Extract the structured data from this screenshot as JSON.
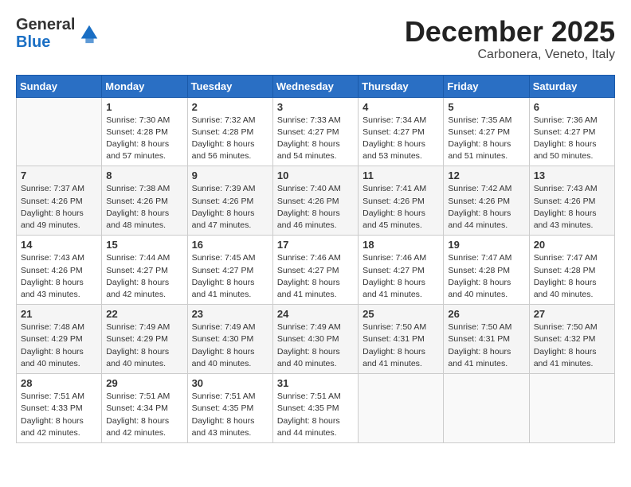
{
  "header": {
    "logo_line1": "General",
    "logo_line2": "Blue",
    "month": "December 2025",
    "location": "Carbonera, Veneto, Italy"
  },
  "weekdays": [
    "Sunday",
    "Monday",
    "Tuesday",
    "Wednesday",
    "Thursday",
    "Friday",
    "Saturday"
  ],
  "weeks": [
    [
      {
        "day": "",
        "sunrise": "",
        "sunset": "",
        "daylight": ""
      },
      {
        "day": "1",
        "sunrise": "7:30 AM",
        "sunset": "4:28 PM",
        "daylight": "8 hours and 57 minutes."
      },
      {
        "day": "2",
        "sunrise": "7:32 AM",
        "sunset": "4:28 PM",
        "daylight": "8 hours and 56 minutes."
      },
      {
        "day": "3",
        "sunrise": "7:33 AM",
        "sunset": "4:27 PM",
        "daylight": "8 hours and 54 minutes."
      },
      {
        "day": "4",
        "sunrise": "7:34 AM",
        "sunset": "4:27 PM",
        "daylight": "8 hours and 53 minutes."
      },
      {
        "day": "5",
        "sunrise": "7:35 AM",
        "sunset": "4:27 PM",
        "daylight": "8 hours and 51 minutes."
      },
      {
        "day": "6",
        "sunrise": "7:36 AM",
        "sunset": "4:27 PM",
        "daylight": "8 hours and 50 minutes."
      }
    ],
    [
      {
        "day": "7",
        "sunrise": "7:37 AM",
        "sunset": "4:26 PM",
        "daylight": "8 hours and 49 minutes."
      },
      {
        "day": "8",
        "sunrise": "7:38 AM",
        "sunset": "4:26 PM",
        "daylight": "8 hours and 48 minutes."
      },
      {
        "day": "9",
        "sunrise": "7:39 AM",
        "sunset": "4:26 PM",
        "daylight": "8 hours and 47 minutes."
      },
      {
        "day": "10",
        "sunrise": "7:40 AM",
        "sunset": "4:26 PM",
        "daylight": "8 hours and 46 minutes."
      },
      {
        "day": "11",
        "sunrise": "7:41 AM",
        "sunset": "4:26 PM",
        "daylight": "8 hours and 45 minutes."
      },
      {
        "day": "12",
        "sunrise": "7:42 AM",
        "sunset": "4:26 PM",
        "daylight": "8 hours and 44 minutes."
      },
      {
        "day": "13",
        "sunrise": "7:43 AM",
        "sunset": "4:26 PM",
        "daylight": "8 hours and 43 minutes."
      }
    ],
    [
      {
        "day": "14",
        "sunrise": "7:43 AM",
        "sunset": "4:26 PM",
        "daylight": "8 hours and 43 minutes."
      },
      {
        "day": "15",
        "sunrise": "7:44 AM",
        "sunset": "4:27 PM",
        "daylight": "8 hours and 42 minutes."
      },
      {
        "day": "16",
        "sunrise": "7:45 AM",
        "sunset": "4:27 PM",
        "daylight": "8 hours and 41 minutes."
      },
      {
        "day": "17",
        "sunrise": "7:46 AM",
        "sunset": "4:27 PM",
        "daylight": "8 hours and 41 minutes."
      },
      {
        "day": "18",
        "sunrise": "7:46 AM",
        "sunset": "4:27 PM",
        "daylight": "8 hours and 41 minutes."
      },
      {
        "day": "19",
        "sunrise": "7:47 AM",
        "sunset": "4:28 PM",
        "daylight": "8 hours and 40 minutes."
      },
      {
        "day": "20",
        "sunrise": "7:47 AM",
        "sunset": "4:28 PM",
        "daylight": "8 hours and 40 minutes."
      }
    ],
    [
      {
        "day": "21",
        "sunrise": "7:48 AM",
        "sunset": "4:29 PM",
        "daylight": "8 hours and 40 minutes."
      },
      {
        "day": "22",
        "sunrise": "7:49 AM",
        "sunset": "4:29 PM",
        "daylight": "8 hours and 40 minutes."
      },
      {
        "day": "23",
        "sunrise": "7:49 AM",
        "sunset": "4:30 PM",
        "daylight": "8 hours and 40 minutes."
      },
      {
        "day": "24",
        "sunrise": "7:49 AM",
        "sunset": "4:30 PM",
        "daylight": "8 hours and 40 minutes."
      },
      {
        "day": "25",
        "sunrise": "7:50 AM",
        "sunset": "4:31 PM",
        "daylight": "8 hours and 41 minutes."
      },
      {
        "day": "26",
        "sunrise": "7:50 AM",
        "sunset": "4:31 PM",
        "daylight": "8 hours and 41 minutes."
      },
      {
        "day": "27",
        "sunrise": "7:50 AM",
        "sunset": "4:32 PM",
        "daylight": "8 hours and 41 minutes."
      }
    ],
    [
      {
        "day": "28",
        "sunrise": "7:51 AM",
        "sunset": "4:33 PM",
        "daylight": "8 hours and 42 minutes."
      },
      {
        "day": "29",
        "sunrise": "7:51 AM",
        "sunset": "4:34 PM",
        "daylight": "8 hours and 42 minutes."
      },
      {
        "day": "30",
        "sunrise": "7:51 AM",
        "sunset": "4:35 PM",
        "daylight": "8 hours and 43 minutes."
      },
      {
        "day": "31",
        "sunrise": "7:51 AM",
        "sunset": "4:35 PM",
        "daylight": "8 hours and 44 minutes."
      },
      {
        "day": "",
        "sunrise": "",
        "sunset": "",
        "daylight": ""
      },
      {
        "day": "",
        "sunrise": "",
        "sunset": "",
        "daylight": ""
      },
      {
        "day": "",
        "sunrise": "",
        "sunset": "",
        "daylight": ""
      }
    ]
  ]
}
